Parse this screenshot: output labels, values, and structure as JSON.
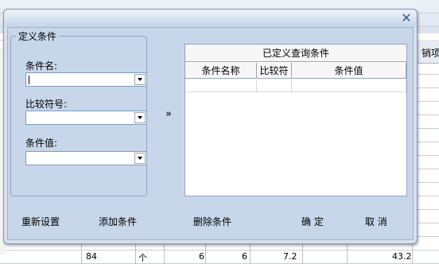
{
  "background": {
    "header_text": "销项",
    "bottom_row": [
      "84",
      "个",
      "6",
      "6",
      "7.2",
      "43.2"
    ]
  },
  "dialog": {
    "close_glyph": "✕",
    "group_title": "定义条件",
    "fields": {
      "name_label": "条件名:",
      "name_value": "",
      "operator_label": "比较符号:",
      "operator_value": "",
      "value_label": "条件值:",
      "value_value": ""
    },
    "arrow_label": "»",
    "table": {
      "title": "已定义查询条件",
      "columns": [
        "条件名称",
        "比较符",
        "条件值"
      ],
      "rows": []
    },
    "buttons": {
      "reset": "重新设置",
      "add": "添加条件",
      "delete": "删除条件",
      "ok": "确 定",
      "cancel": "取 消"
    }
  },
  "colors": {
    "dialog_bg": "#c8d6ea",
    "border": "#7e97c2",
    "close_icon": "#3b5b8c"
  }
}
